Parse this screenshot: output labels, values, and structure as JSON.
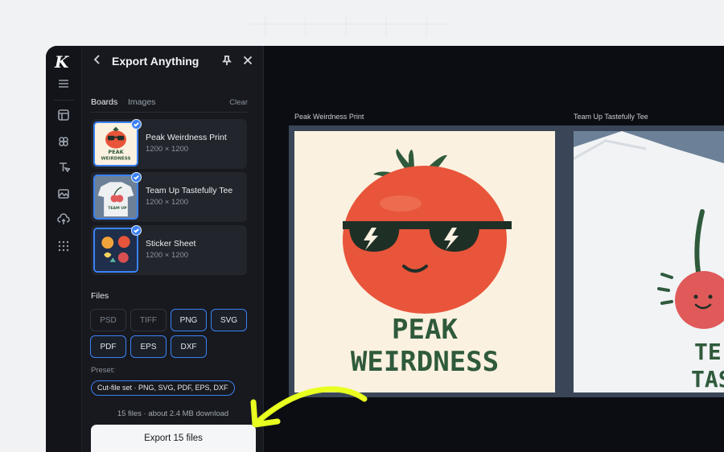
{
  "panel": {
    "title": "Export Anything",
    "tabs": {
      "boards": "Boards",
      "images": "Images",
      "clear": "Clear"
    },
    "boards": [
      {
        "name": "Peak Weirdness Print",
        "dims": "1200 × 1200"
      },
      {
        "name": "Team Up Tastefully Tee",
        "dims": "1200 × 1200"
      },
      {
        "name": "Sticker Sheet",
        "dims": "1200 × 1200"
      }
    ],
    "files_label": "Files",
    "formats": [
      {
        "label": "PSD",
        "selected": false
      },
      {
        "label": "TIFF",
        "selected": false
      },
      {
        "label": "PNG",
        "selected": true
      },
      {
        "label": "SVG",
        "selected": true
      },
      {
        "label": "PDF",
        "selected": true
      },
      {
        "label": "EPS",
        "selected": true
      },
      {
        "label": "DXF",
        "selected": true
      }
    ],
    "preset_label": "Preset:",
    "preset_value": "Cut-file set · PNG, SVG, PDF, EPS, DXF",
    "summary": "15 files · about 2.4 MB download",
    "export_label": "Export 15 files"
  },
  "canvas": {
    "artboard1_label": "Peak Weirdness Print",
    "artboard2_label": "Team Up Tastefully Tee",
    "art1_text_line1": "PEAK",
    "art1_text_line2": "WEIRDNESS",
    "art2_text_line1": "TE",
    "art2_text_line2": "TAS"
  },
  "colors": {
    "accent": "#3b82f6",
    "annotation_arrow": "#e8ff1f",
    "tomato": "#e8553a",
    "ink_green": "#2f5a3c"
  }
}
